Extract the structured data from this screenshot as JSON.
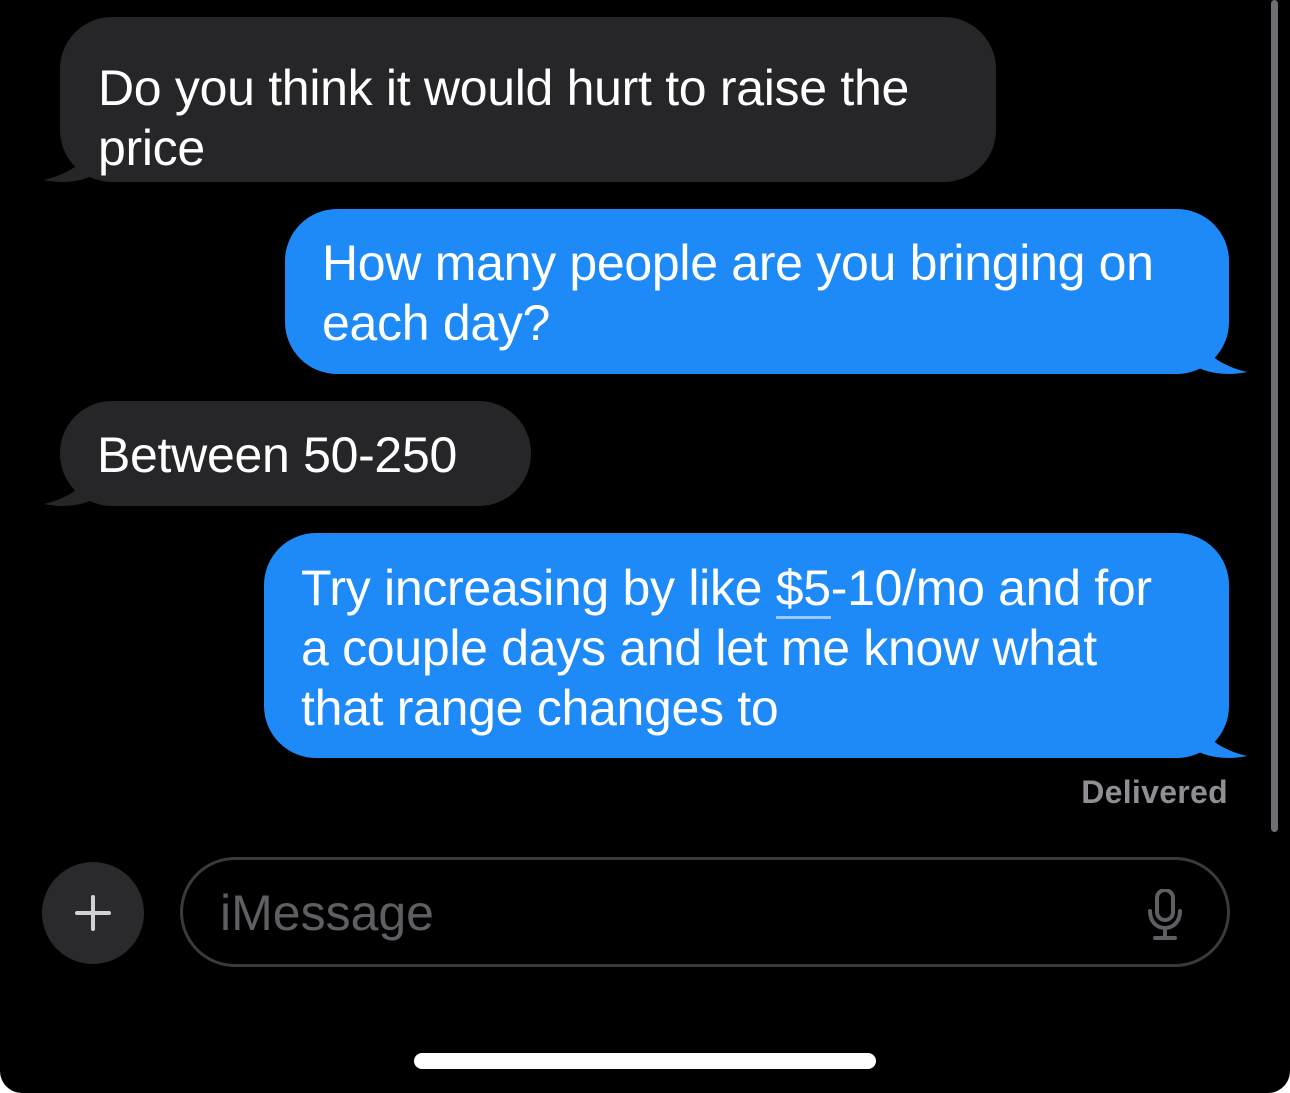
{
  "conversation": {
    "messages": [
      {
        "direction": "received",
        "lines": [
          "Do you think it would hurt to raise the",
          "price"
        ]
      },
      {
        "direction": "sent",
        "lines": [
          "How many people are you bringing on",
          "each day?"
        ]
      },
      {
        "direction": "received",
        "lines": [
          "Between 50-250"
        ]
      },
      {
        "direction": "sent",
        "line1_before": "Try increasing by like ",
        "line1_link": "$5",
        "line1_after": "-10/mo and for",
        "lines": [
          "Try increasing by like $5-10/mo and for",
          "a couple days and let me know what",
          "that range changes to"
        ]
      }
    ],
    "delivery_status": "Delivered"
  },
  "input_bar": {
    "plus_icon": "plus-icon",
    "placeholder": "iMessage",
    "mic_icon": "microphone-icon"
  },
  "colors": {
    "background": "#000000",
    "received_bubble": "#262629",
    "sent_bubble": "#1d8af8",
    "status_text": "#8e8e93"
  }
}
